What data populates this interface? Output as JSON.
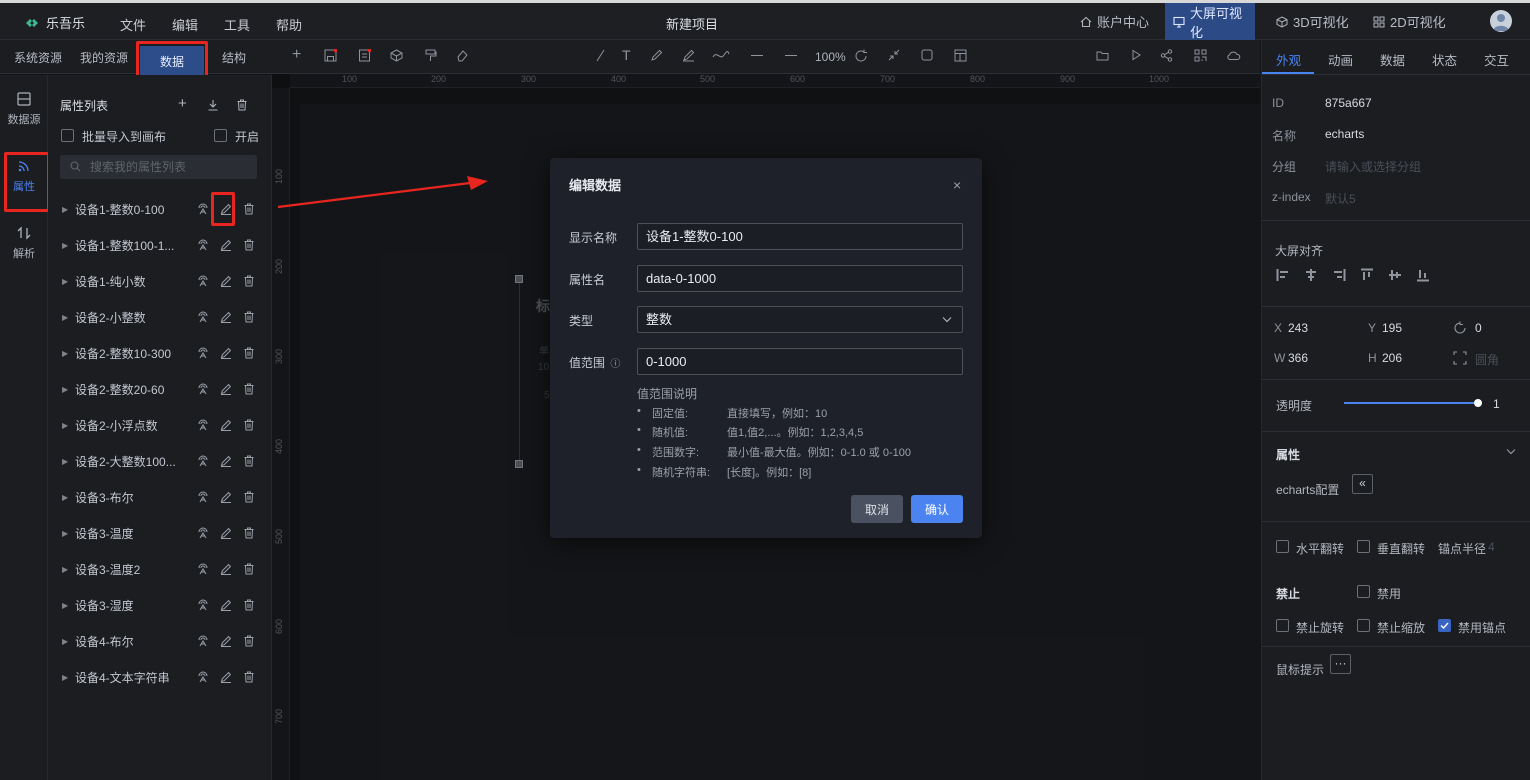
{
  "app": {
    "name": "乐吾乐",
    "project_title": "新建项目"
  },
  "menu": [
    "文件",
    "编辑",
    "工具",
    "帮助"
  ],
  "top_nav": [
    {
      "label": "账户中心",
      "icon": "home-icon"
    },
    {
      "label": "大屏可视化",
      "icon": "monitor-icon",
      "active": true
    },
    {
      "label": "3D可视化",
      "icon": "cube-icon"
    },
    {
      "label": "2D可视化",
      "icon": "grid-icon"
    }
  ],
  "left_tabs": [
    "系统资源",
    "我的资源",
    "数据",
    "结构"
  ],
  "side_nav": [
    {
      "label": "数据源",
      "icon": "database-icon"
    },
    {
      "label": "属性",
      "icon": "signal-icon",
      "active": true
    },
    {
      "label": "解析",
      "icon": "swap-icon"
    }
  ],
  "prop_panel": {
    "title": "属性列表",
    "batch_import": "批量导入到画布",
    "enable": "开启",
    "search_placeholder": "搜索我的属性列表",
    "items": [
      "设备1-整数0-100",
      "设备1-整数100-1...",
      "设备1-纯小数",
      "设备2-小整数",
      "设备2-整数10-300",
      "设备2-整数20-60",
      "设备2-小浮点数",
      "设备2-大整数100...",
      "设备3-布尔",
      "设备3-温度",
      "设备3-温度2",
      "设备3-湿度",
      "设备4-布尔",
      "设备4-文本字符串"
    ]
  },
  "toolbar": {
    "zoom": "100%"
  },
  "ruler": {
    "h": [
      "100",
      "200",
      "300",
      "400",
      "500",
      "600",
      "700",
      "800",
      "900",
      "1000"
    ],
    "v": [
      "100",
      "200",
      "300",
      "400",
      "500",
      "600",
      "700"
    ]
  },
  "canvas_peek": {
    "a": "标",
    "b": "单",
    "c": "10",
    "d": "5"
  },
  "dialog": {
    "title": "编辑数据",
    "display_name_label": "显示名称",
    "display_name_value": "设备1-整数0-100",
    "prop_name_label": "属性名",
    "prop_name_value": "data-0-1000",
    "type_label": "类型",
    "type_value": "整数",
    "range_label": "值范围",
    "range_value": "0-1000",
    "range_help_title": "值范围说明",
    "range_help": [
      {
        "k": "固定值:",
        "v": "直接填写，例如：10"
      },
      {
        "k": "随机值:",
        "v": "值1,值2,...。例如：1,2,3,4,5"
      },
      {
        "k": "范围数字:",
        "v": "最小值-最大值。例如：0-1.0 或 0-100"
      },
      {
        "k": "随机字符串:",
        "v": "[长度]。例如：[8]"
      }
    ],
    "cancel": "取消",
    "confirm": "确认"
  },
  "right_panel": {
    "tabs": [
      "外观",
      "动画",
      "数据",
      "状态",
      "交互"
    ],
    "id_label": "ID",
    "id_value": "875a667",
    "name_label": "名称",
    "name_value": "echarts",
    "group_label": "分组",
    "group_placeholder": "请输入或选择分组",
    "zindex_label": "z-index",
    "zindex_placeholder": "默认5",
    "align_title": "大屏对齐",
    "x_label": "X",
    "x_value": "243",
    "y_label": "Y",
    "y_value": "195",
    "rot_value": "0",
    "w_label": "W",
    "w_value": "366",
    "h_label": "H",
    "h_value": "206",
    "radius_label": "圆角",
    "opacity_label": "透明度",
    "opacity_value": "1",
    "opacity_fraction": 1.0,
    "props_title": "属性",
    "echarts_config": "echarts配置",
    "flip_h": "水平翻转",
    "flip_v": "垂直翻转",
    "anchor_radius_label": "锚点半径",
    "anchor_radius_value": "4",
    "disable_title": "禁止",
    "disable": "禁用",
    "disable_rotate": "禁止旋转",
    "disable_scale": "禁止缩放",
    "disable_anchor": "禁用锚点",
    "mouse_tip": "鼠标提示",
    "more": "···"
  },
  "colors": {
    "accent": "#4b83f0",
    "active_tab": "#2d4d8a",
    "highlight": "#e8261f"
  }
}
